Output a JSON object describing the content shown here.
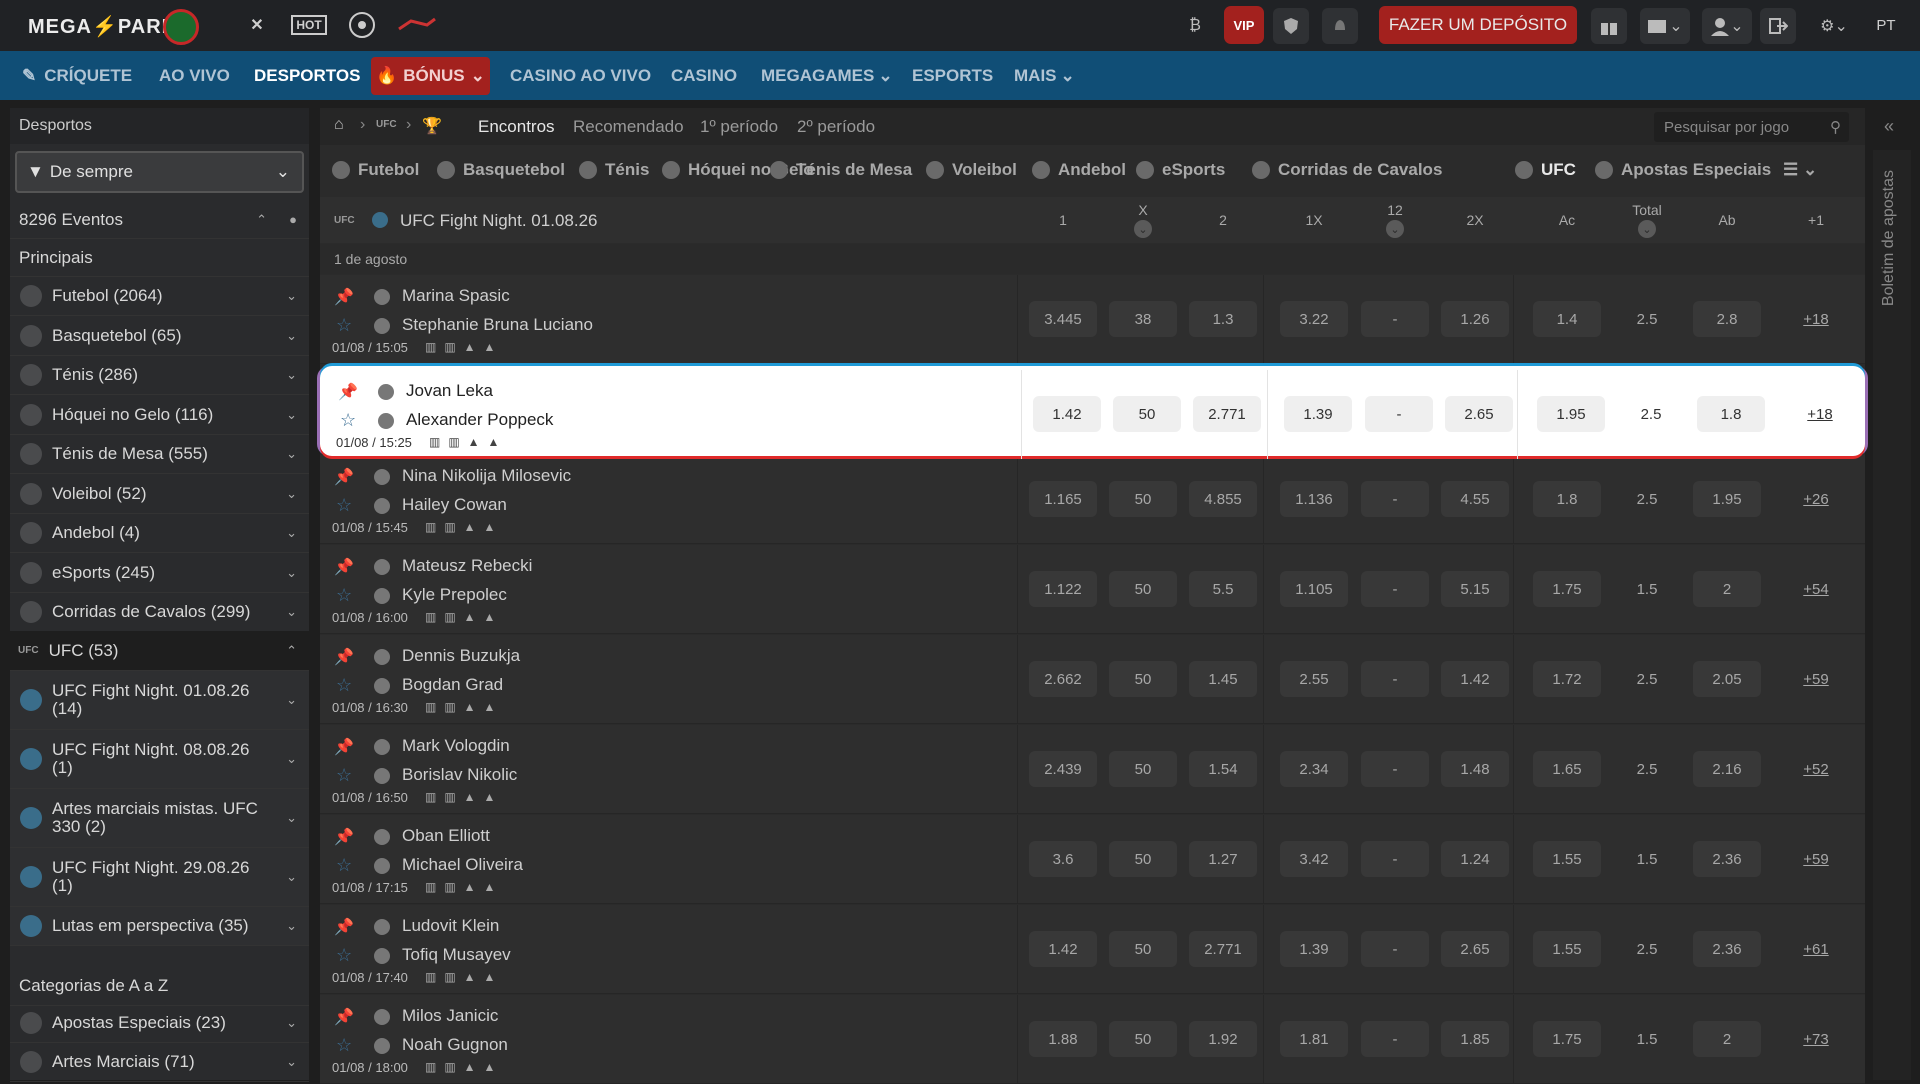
{
  "topbar": {
    "logo": "MEGA⚡PARI",
    "vip": "VIP",
    "deposit": "FAZER UM DEPÓSITO",
    "lang": "PT",
    "icons": [
      "icc-icon",
      "hot-icon",
      "football-icon",
      "tick-icon",
      "bitcoin-icon",
      "shield-icon",
      "bell-icon",
      "gift-icon",
      "mail-icon",
      "user-icon",
      "logout-icon",
      "settings-icon"
    ]
  },
  "nav": {
    "items": [
      "CRÍQUETE",
      "AO VIVO",
      "DESPORTOS",
      "BÓNUS",
      "CASINO AO VIVO",
      "CASINO",
      "MEGAGAMES",
      "ESPORTS",
      "MAIS"
    ]
  },
  "sidebar": {
    "header": "Desportos",
    "filter": "De sempre",
    "events": "8296 Eventos",
    "principais": "Principais",
    "sports": [
      "Futebol (2064)",
      "Basquetebol (65)",
      "Ténis (286)",
      "Hóquei no Gelo (116)",
      "Ténis de Mesa (555)",
      "Voleibol (52)",
      "Andebol (4)",
      "eSports (245)",
      "Corridas de Cavalos (299)"
    ],
    "ufc": "UFC (53)",
    "ufc_items": [
      {
        "l1": "UFC Fight Night. 01.08.26",
        "l2": "(14)"
      },
      {
        "l1": "UFC Fight Night. 08.08.26",
        "l2": "(1)"
      },
      {
        "l1": "Artes marciais mistas. UFC",
        "l2": "330 (2)"
      },
      {
        "l1": "UFC Fight Night. 29.08.26",
        "l2": "(1)"
      },
      {
        "l1": "Lutas em perspectiva (35)",
        "l2": ""
      }
    ],
    "categorias": "Categorias de A a Z",
    "cat_items": [
      "Apostas Especiais (23)",
      "Artes Marciais (71)"
    ]
  },
  "crumbs": {
    "tabs": [
      "Encontros",
      "Recomendado",
      "1º período",
      "2º período"
    ],
    "search_placeholder": "Pesquisar por jogo"
  },
  "sports_tabs": [
    "Futebol",
    "Basquetebol",
    "Ténis",
    "Hóquei no Gelo",
    "Ténis de Mesa",
    "Voleibol",
    "Andebol",
    "eSports",
    "Corridas de Cavalos",
    "UFC",
    "Apostas Especiais"
  ],
  "league": {
    "title": "UFC Fight Night. 01.08.26",
    "cols": [
      "1",
      "X",
      "2",
      "1X",
      "12",
      "2X",
      "Ac",
      "Total",
      "Ab",
      "+1"
    ],
    "date": "1 de agosto"
  },
  "matches": [
    {
      "p1": "Marina Spasic",
      "p2": "Stephanie Bruna Luciano",
      "time": "01/08 / 15:05",
      "odds": [
        "3.445",
        "38",
        "1.3",
        "3.22",
        "-",
        "1.26",
        "1.4",
        "2.5",
        "2.8"
      ],
      "more": "+18"
    },
    {
      "p1": "Jovan Leka",
      "p2": "Alexander Poppeck",
      "time": "01/08 / 15:25",
      "odds": [
        "1.42",
        "50",
        "2.771",
        "1.39",
        "-",
        "2.65",
        "1.95",
        "2.5",
        "1.8"
      ],
      "more": "+18"
    },
    {
      "p1": "Nina Nikolija Milosevic",
      "p2": "Hailey Cowan",
      "time": "01/08 / 15:45",
      "odds": [
        "1.165",
        "50",
        "4.855",
        "1.136",
        "-",
        "4.55",
        "1.8",
        "2.5",
        "1.95"
      ],
      "more": "+26"
    },
    {
      "p1": "Mateusz Rebecki",
      "p2": "Kyle Prepolec",
      "time": "01/08 / 16:00",
      "odds": [
        "1.122",
        "50",
        "5.5",
        "1.105",
        "-",
        "5.15",
        "1.75",
        "1.5",
        "2"
      ],
      "more": "+54"
    },
    {
      "p1": "Dennis Buzukja",
      "p2": "Bogdan Grad",
      "time": "01/08 / 16:30",
      "odds": [
        "2.662",
        "50",
        "1.45",
        "2.55",
        "-",
        "1.42",
        "1.72",
        "2.5",
        "2.05"
      ],
      "more": "+59"
    },
    {
      "p1": "Mark Vologdin",
      "p2": "Borislav Nikolic",
      "time": "01/08 / 16:50",
      "odds": [
        "2.439",
        "50",
        "1.54",
        "2.34",
        "-",
        "1.48",
        "1.65",
        "2.5",
        "2.16"
      ],
      "more": "+52"
    },
    {
      "p1": "Oban Elliott",
      "p2": "Michael Oliveira",
      "time": "01/08 / 17:15",
      "odds": [
        "3.6",
        "50",
        "1.27",
        "3.42",
        "-",
        "1.24",
        "1.55",
        "1.5",
        "2.36"
      ],
      "more": "+59"
    },
    {
      "p1": "Ludovit Klein",
      "p2": "Tofiq Musayev",
      "time": "01/08 / 17:40",
      "odds": [
        "1.42",
        "50",
        "2.771",
        "1.39",
        "-",
        "2.65",
        "1.55",
        "2.5",
        "2.36"
      ],
      "more": "+61"
    },
    {
      "p1": "Milos Janicic",
      "p2": "Noah Gugnon",
      "time": "01/08 / 18:00",
      "odds": [
        "1.88",
        "50",
        "1.92",
        "1.81",
        "-",
        "1.85",
        "1.75",
        "1.5",
        "2"
      ],
      "more": "+73"
    }
  ],
  "rightbar": {
    "label": "Boletim de apostas"
  }
}
